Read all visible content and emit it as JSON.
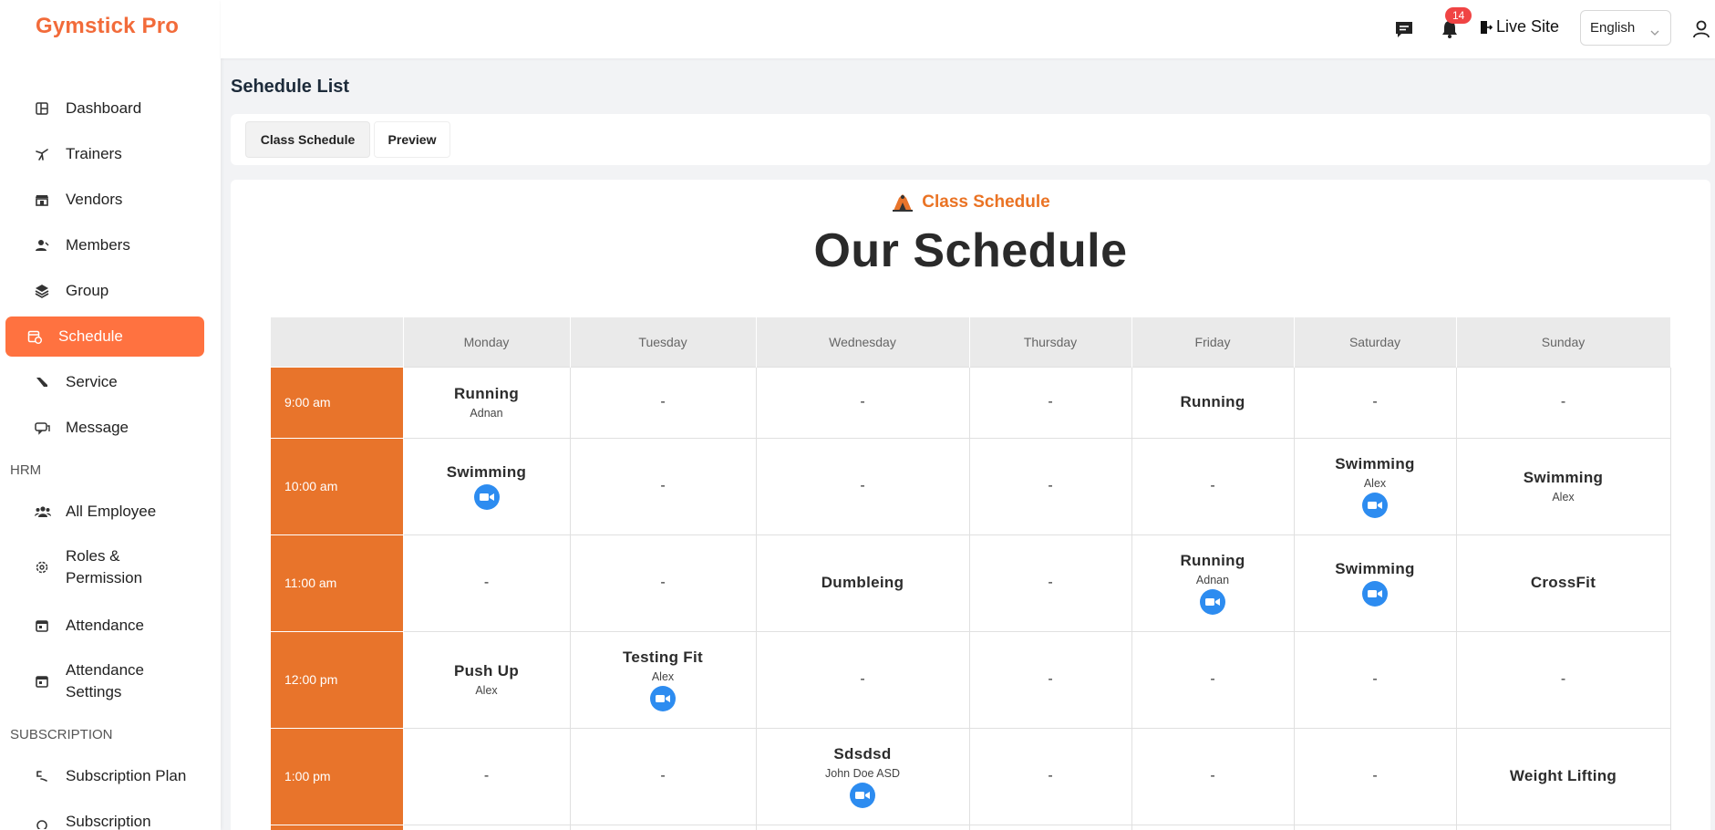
{
  "brand": "Gymstick Pro",
  "nav": [
    {
      "label": "Dashboard",
      "icon": "dashboard-icon"
    },
    {
      "label": "Trainers",
      "icon": "trainers-icon"
    },
    {
      "label": "Vendors",
      "icon": "store-icon"
    },
    {
      "label": "Members",
      "icon": "members-icon"
    },
    {
      "label": "Group",
      "icon": "layers-icon"
    },
    {
      "label": "Schedule",
      "icon": "calendar-clock-icon"
    },
    {
      "label": "Service",
      "icon": "service-icon"
    },
    {
      "label": "Message",
      "icon": "message-icon"
    },
    {
      "label": "All Employee",
      "icon": "people-icon"
    },
    {
      "label": "Roles & Permission",
      "icon": "gear-icon"
    },
    {
      "label": "Attendance",
      "icon": "calendar-icon"
    },
    {
      "label": "Attendance Settings",
      "icon": "calendar-icon"
    },
    {
      "label": "Subscription Plan",
      "icon": "subscription-icon"
    },
    {
      "label": "Subscription",
      "icon": "subscription-icon"
    }
  ],
  "sections": {
    "hrm": "HRM",
    "subscription": "SUBSCRIPTION"
  },
  "header": {
    "notification_count": "14",
    "live_site": "Live Site",
    "language": "English"
  },
  "page_title": "Sehedule List",
  "tabs": [
    "Class Schedule",
    "Preview"
  ],
  "preview": {
    "section_label": "Class Schedule",
    "title": "Our Schedule"
  },
  "schedule": {
    "days": [
      "Monday",
      "Tuesday",
      "Wednesday",
      "Thursday",
      "Friday",
      "Saturday",
      "Sunday"
    ],
    "rows": [
      {
        "time": "9:00 am",
        "cells": [
          {
            "name": "Running",
            "trainer": "Adnan",
            "video": false
          },
          null,
          null,
          null,
          {
            "name": "Running",
            "trainer": "",
            "video": false
          },
          null,
          null
        ]
      },
      {
        "time": "10:00 am",
        "cells": [
          {
            "name": "Swimming",
            "trainer": "",
            "video": true
          },
          null,
          null,
          null,
          null,
          {
            "name": "Swimming",
            "trainer": "Alex",
            "video": true
          },
          {
            "name": "Swimming",
            "trainer": "Alex",
            "video": false
          }
        ]
      },
      {
        "time": "11:00 am",
        "cells": [
          null,
          null,
          {
            "name": "Dumbleing",
            "trainer": "",
            "video": false
          },
          null,
          {
            "name": "Running",
            "trainer": "Adnan",
            "video": true
          },
          {
            "name": "Swimming",
            "trainer": "",
            "video": true
          },
          {
            "name": "CrossFit",
            "trainer": "",
            "video": false
          }
        ]
      },
      {
        "time": "12:00 pm",
        "cells": [
          {
            "name": "Push Up",
            "trainer": "Alex",
            "video": false
          },
          {
            "name": "Testing Fit",
            "trainer": "Alex",
            "video": true
          },
          null,
          null,
          null,
          null,
          null
        ]
      },
      {
        "time": "1:00 pm",
        "cells": [
          null,
          null,
          {
            "name": "Sdsdsd",
            "trainer": "John Doe ASD",
            "video": true
          },
          null,
          null,
          null,
          {
            "name": "Weight Lifting",
            "trainer": "",
            "video": false
          }
        ]
      },
      {
        "time": "",
        "cells": [
          null,
          null,
          null,
          null,
          null,
          null,
          null
        ]
      }
    ],
    "empty_marker": "-"
  },
  "colors": {
    "brand": "#f26b3a",
    "active_nav": "#ff7240",
    "time_cell": "#e8742b",
    "video_button": "#2d8cf0",
    "badge": "#f04444"
  }
}
